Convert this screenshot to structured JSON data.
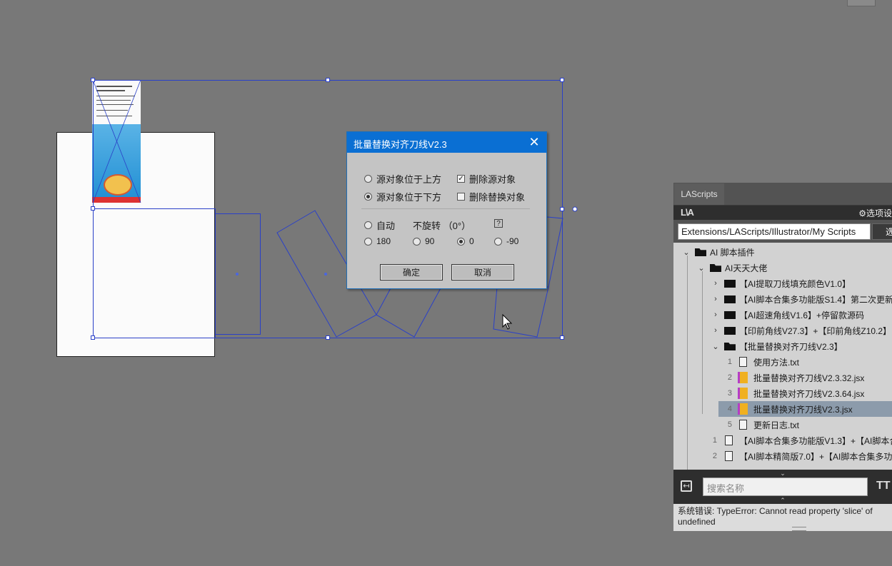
{
  "dialog": {
    "title": "批量替换对齐刀线V2.3",
    "close": "✕",
    "position_options": [
      {
        "label": "源对象位于上方",
        "checked": false
      },
      {
        "label": "源对象位于下方",
        "checked": true
      }
    ],
    "checkboxes": [
      {
        "label": "删除源对象",
        "checked": true
      },
      {
        "label": "删除替换对象",
        "checked": false
      }
    ],
    "rotation_auto": "自动",
    "rotation_label": "不旋转 （0°）",
    "help": "?",
    "rotation_options": [
      {
        "label": "180",
        "checked": false
      },
      {
        "label": "90",
        "checked": false
      },
      {
        "label": "0",
        "checked": true
      },
      {
        "label": "-90",
        "checked": false
      }
    ],
    "ok": "确定",
    "cancel": "取消"
  },
  "panel": {
    "tab": "LAScripts",
    "logo": "L\\A",
    "settings": "⚙选项设",
    "path": "Extensions/LAScripts/Illustrator/My Scripts",
    "path_button": "选",
    "tree": [
      {
        "label": "AI 脚本插件",
        "type": "folder-open",
        "arrow": "⌄"
      },
      {
        "label": "AI天天大佬",
        "type": "folder-open",
        "arrow": "⌄"
      },
      {
        "label": "【AI提取刀线填充颜色V1.0】",
        "type": "folder",
        "arrow": "›"
      },
      {
        "label": "【AI脚本合集多功能版S1.4】第二次更新",
        "type": "folder",
        "arrow": "›"
      },
      {
        "label": "【AI超速角线V1.6】+停留款源码",
        "type": "folder",
        "arrow": "›"
      },
      {
        "label": "【印前角线V27.3】+【印前角线Z10.2】",
        "type": "folder",
        "arrow": "›"
      },
      {
        "label": "【批量替换对齐刀线V2.3】",
        "type": "folder-open",
        "arrow": "⌄"
      },
      {
        "num": "1",
        "label": "使用方法.txt",
        "type": "txt"
      },
      {
        "num": "2",
        "label": "批量替换对齐刀线V2.3.32.jsx",
        "type": "jsx"
      },
      {
        "num": "3",
        "label": "批量替换对齐刀线V2.3.64.jsx",
        "type": "jsx"
      },
      {
        "num": "4",
        "label": "批量替换对齐刀线V2.3.jsx",
        "type": "jsx",
        "selected": true
      },
      {
        "num": "5",
        "label": "更新日志.txt",
        "type": "txt"
      },
      {
        "num": "1",
        "label": "【AI脚本合集多功能版V1.3】+【AI脚本合",
        "type": "script"
      },
      {
        "num": "2",
        "label": "【AI脚本精简版7.0】+【AI脚本合集多功",
        "type": "script"
      }
    ],
    "scroll_down": "⌄",
    "search_placeholder": "搜索名称",
    "text_icon": "TT",
    "scroll_up": "⌃",
    "status": "系统错误: TypeError: Cannot read property 'slice' of undefined"
  }
}
